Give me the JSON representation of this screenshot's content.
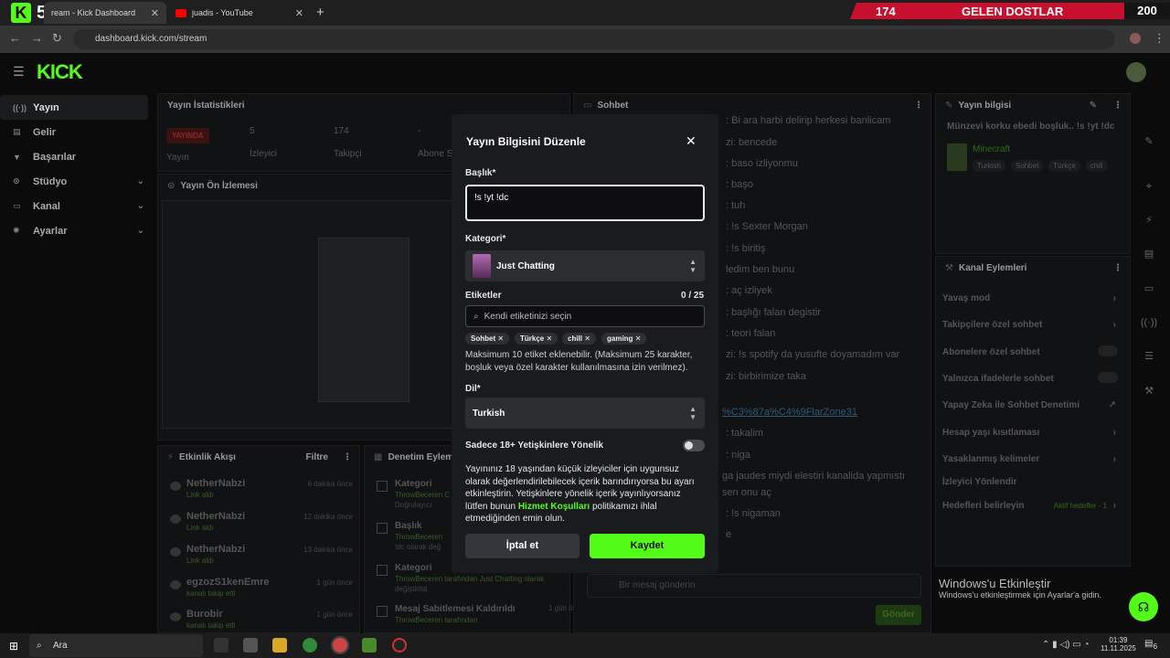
{
  "browser": {
    "tabs": [
      {
        "label": "ream - Kick Dashboard"
      },
      {
        "label": "juadis - YouTube"
      }
    ],
    "url": "dashboard.kick.com/stream"
  },
  "overlay": {
    "left_count": "174",
    "title": "GELEN DOSTLAR",
    "right_count": "200"
  },
  "kick_badge": {
    "k": "K",
    "n": "5"
  },
  "logo": "KICK",
  "sidebar": {
    "items": [
      {
        "label": "Yayın",
        "icon": "radio-icon"
      },
      {
        "label": "Gelir",
        "icon": "bank-icon"
      },
      {
        "label": "Başarılar",
        "icon": "trophy-icon"
      },
      {
        "label": "Stüdyo",
        "icon": "studio-icon"
      },
      {
        "label": "Kanal",
        "icon": "channel-icon"
      },
      {
        "label": "Ayarlar",
        "icon": "gear-icon"
      }
    ]
  },
  "stats": {
    "title": "Yayın İstatistikleri",
    "live_badge": "YAYINDA",
    "live_label": "Yayın",
    "viewers_value": "5",
    "viewers_label": "İzleyici",
    "followers_value": "174",
    "followers_label": "Takipçi",
    "subs_value": "-",
    "subs_label": "Abone S"
  },
  "preview": {
    "title": "Yayın Ön İzlemesi"
  },
  "activity": {
    "title": "Etkinlik Akışı",
    "filter": "Filtre",
    "rows": [
      {
        "name": "NetherNabzi",
        "sub": "Link aldı",
        "time": "6 dakika önce"
      },
      {
        "name": "NetherNabzi",
        "sub": "Link aldı",
        "time": "12 dakika önce"
      },
      {
        "name": "NetherNabzi",
        "sub": "Link aldı",
        "time": "13 dakika önce"
      },
      {
        "name": "egzozS1kenEmre",
        "sub": "kanalı takip etti",
        "time": "1 gün önce"
      },
      {
        "name": "Burobir",
        "sub": "kanalı takip etti",
        "time": "1 gün önce"
      }
    ]
  },
  "moderation": {
    "title": "Denetim Eylemi",
    "rows": [
      {
        "name": "Kategori",
        "sub": "ThrowBeceren C",
        "sub2": "Doğrulayıcı"
      },
      {
        "name": "Başlık",
        "sub": "ThrowBeceren",
        "sub2": "!dc olarak değ"
      },
      {
        "name": "Kategori",
        "sub": "ThrowBeceren tarafından Just Chatting olarak",
        "sub2": "değiştirildi"
      },
      {
        "name": "Mesaj Sabitlemesi Kaldırıldı",
        "sub": "ThrowBeceren tarafından",
        "time": "1 gün önce"
      }
    ]
  },
  "chat": {
    "title": "Sohbet",
    "lines": [
      ": Bi ara harbi delirip herkesi banlicam",
      "zi: bencede",
      ": baso izliyonmu",
      ": başo",
      ": tuh",
      ": !s Sexter Morgan",
      ": !s biritiş",
      "ledim ben bunu",
      ": aç izliyek",
      ": başlığı falan degistir",
      ": teori falan",
      "zi: !s spotify da yusufte doyamadım var",
      "zi: birbirimize taka",
      "%C3%87a%C4%9FlarZone31",
      ": takalim",
      ": niga",
      "ga jaudes miydi elestiri kanalida yapmıstı",
      "sen onu aç",
      ": !s nigaman",
      "e"
    ],
    "input_placeholder": "Bir mesaj gönderin",
    "send": "Gönder"
  },
  "stream_info": {
    "title": "Yayın bilgisi",
    "stream_title": "Münzevi korku ebedi boşluk.. !s !yt !dc",
    "category": "Minecraft",
    "tags": [
      "Turkish",
      "Sohbet",
      "Türkçe",
      "chill"
    ]
  },
  "channel_actions": {
    "title": "Kanal Eylemleri",
    "items": [
      {
        "label": "Yavaş mod",
        "type": "arrow"
      },
      {
        "label": "Takipçilere özel sohbet",
        "type": "arrow"
      },
      {
        "label": "Abonelere özel sohbet",
        "type": "toggle"
      },
      {
        "label": "Yalnızca ifadelerle sohbet",
        "type": "toggle"
      },
      {
        "label": "Yapay Zeka ile Sohbet Denetimi",
        "type": "external"
      },
      {
        "label": "Hesap yaşı kısıtlaması",
        "type": "arrow"
      },
      {
        "label": "Yasaklanmış kelimeler",
        "type": "arrow"
      },
      {
        "label": "İzleyici Yönlendir",
        "type": "none"
      },
      {
        "label": "Hedefleri belirleyin",
        "type": "arrow",
        "note": "Aktif hedefler - 1"
      }
    ]
  },
  "modal": {
    "title": "Yayın Bilgisini Düzenle",
    "title_label": "Başlık*",
    "title_value": "!s !yt !dc",
    "category_label": "Kategori*",
    "category_value": "Just Chatting",
    "tags_label": "Etiketler",
    "tags_count": "0 / 25",
    "tags_placeholder": "Kendi etiketinizi seçin",
    "tags": [
      "Sohbet",
      "Türkçe",
      "chill",
      "gaming"
    ],
    "tags_help": "Maksimum 10 etiket eklenebilir. (Maksimum 25 karakter, boşluk veya özel karakter kullanılmasına izin verilmez).",
    "language_label": "Dil*",
    "language_value": "Turkish",
    "adult_label": "Sadece 18+ Yetişkinlere Yönelik",
    "adult_on": false,
    "warning_pre": "Yayınınız 18 yaşından küçük izleyiciler için uygunsuz olarak değerlendirilebilecek içerik barındırıyorsa bu ayarı etkinleştirin. Yetişkinlere yönelik içerik yayınlıyorsanız lütfen bunun ",
    "warning_link": "Hizmet Koşulları",
    "warning_post": " politikamızı ihlal etmediğinden emin olun.",
    "cancel": "İptal et",
    "save": "Kaydet"
  },
  "windows": {
    "activate_title": "Windows'u Etkinleştir",
    "activate_sub": "Windows'u etkinleştirmek için Ayarlar'a gidin.",
    "search": "Ara",
    "time": "01:39",
    "date": "11.11.2025",
    "notif_count": "6"
  },
  "colors": {
    "accent": "#53fc18",
    "live": "#c8102e",
    "panel": "#111214",
    "modal": "#1a1b1e"
  }
}
